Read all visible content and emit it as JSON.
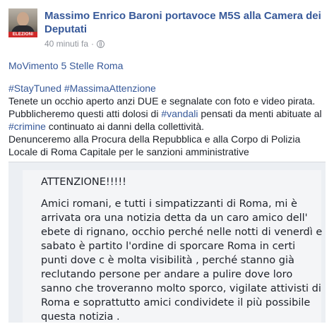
{
  "post": {
    "author": "Massimo Enrico Baroni portavoce M5S alla Camera dei Deputati",
    "time": "40 minuti fa",
    "privacy_icon": "globe-icon",
    "avatar_strip_text": "ELEZIONI",
    "lines": {
      "page_name": "MoVimento 5 Stelle Roma",
      "hashtag_stay_tuned": "#StayTuned",
      "hashtag_massima_attenzione": "#MassimaAttenzione",
      "p1": "Tenete un occhio aperto anzi DUE e segnalate con foto e video pirata. Pubblicheremo questi atti dolosi di ",
      "hashtag_vandali": "#vandali",
      "p1b": " pensati da menti abituate al ",
      "hashtag_crimine": "#crimine",
      "p1c": " continuato ai danni della collettività.",
      "p2": "Denunceremo alla Procura della Repubblica e alla Corpo di Polizia Locale di Roma Capitale per le sanzioni amministrative"
    },
    "shared_image": {
      "title": "ATTENZIONE!!!!!",
      "text": "Amici romani, e tutti i simpatizzanti di Roma, mi è arrivata ora una notizia detta da un caro amico dell' ebete di rignano, occhio perché nelle notti di venerdì e sabato è partito l'ordine di sporcare Roma in certi punti dove c è molta visibilità , perché stanno già reclutando persone per andare a pulire dove loro sanno che troveranno molto sporco, vigilate attivisti di Roma e soprattutto amici condividete il più possibile questa notizia ."
    }
  }
}
